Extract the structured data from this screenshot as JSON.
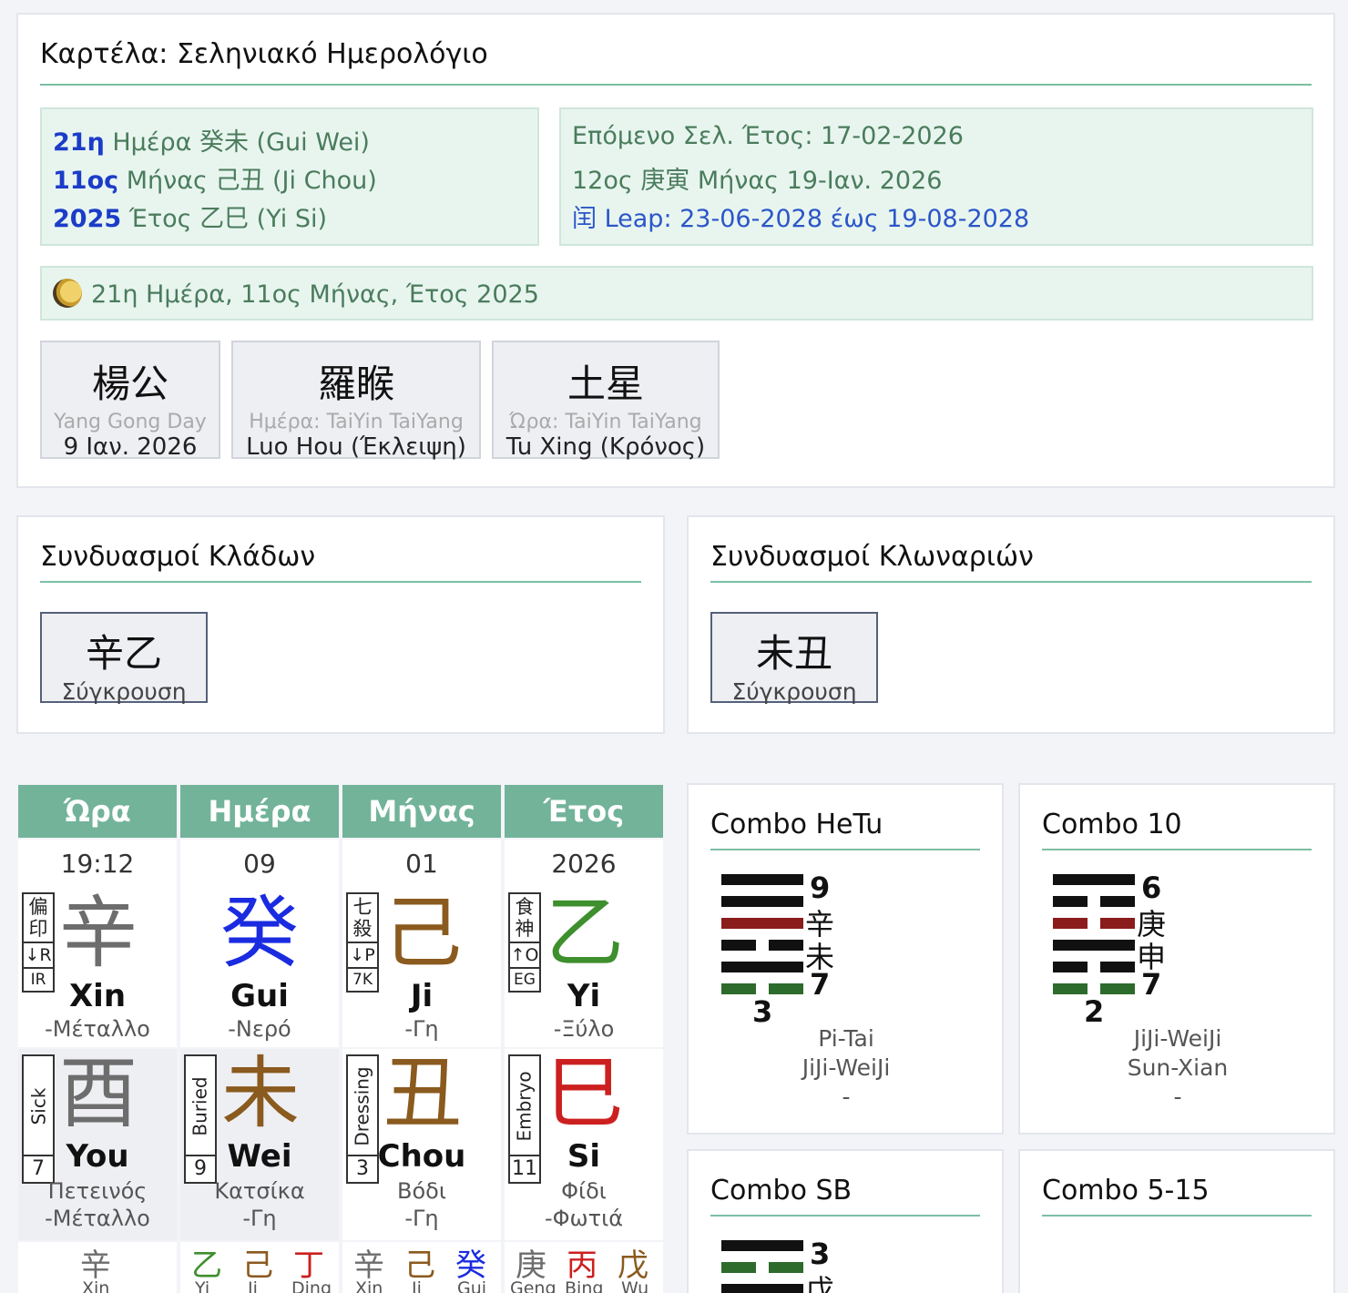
{
  "top": {
    "title": "Καρτέλα: Σεληνιακό Ημερολόγιο",
    "left_box": [
      {
        "num": "21η",
        "text": " Ημέρα 癸未 (Gui Wei)"
      },
      {
        "num": "11ος",
        "text": " Μήνας 己丑 (Ji Chou)"
      },
      {
        "num": "2025",
        "text": " Έτος 乙巳 (Yi Si)"
      }
    ],
    "right_box": {
      "next_year": "Επόμενο Σελ. Έτος: 17-02-2026",
      "next_month": "12ος 庚寅 Μήνας 19-Ιαν. 2026",
      "leap": "闰 Leap: 23-06-2028 έως 19-08-2028"
    },
    "moon_line": "21η Ημέρα, 11ος Μήνας, Έτος 2025",
    "tiles": [
      {
        "big": "楊公",
        "sub": "Yang Gong Day",
        "foot": "9 Ιαν. 2026"
      },
      {
        "big": "羅睺",
        "sub": "Ημέρα: TaiYin TaiYang",
        "foot": "Luo Hou (Έκλειψη)"
      },
      {
        "big": "土星",
        "sub": "Ώρα: TaiYin TaiYang",
        "foot": "Tu Xing (Κρόνος)"
      }
    ]
  },
  "stem_combos": {
    "title": "Συνδυασμοί Κλάδων",
    "tile": {
      "big": "辛乙",
      "sub": "Σύγκρουση"
    }
  },
  "branch_combos": {
    "title": "Συνδυασμοί Κλωναριών",
    "tile": {
      "big": "未丑",
      "sub": "Σύγκρουση"
    }
  },
  "pillars": [
    {
      "header": "Ώρα",
      "date": "19:12",
      "stem": {
        "tag1": "偏印",
        "tag2": "↓R",
        "tag3": "IR",
        "glyph": "辛",
        "pinyin": "Xin",
        "element": "-Μέταλλο",
        "color": "gray"
      },
      "branch": {
        "tag": "Sick",
        "num": "7",
        "glyph": "酉",
        "pinyin": "You",
        "animal": "Πετεινός",
        "element": "-Μέταλλο",
        "color": "gray"
      },
      "hidden": [
        {
          "g": "辛",
          "p": "Xin",
          "color": "gray"
        }
      ]
    },
    {
      "header": "Ημέρα",
      "date": "09",
      "stem": {
        "tag1": "",
        "tag2": "",
        "tag3": "",
        "glyph": "癸",
        "pinyin": "Gui",
        "element": "-Νερό",
        "color": "bl"
      },
      "branch": {
        "tag": "Buried",
        "num": "9",
        "glyph": "未",
        "pinyin": "Wei",
        "animal": "Κατσίκα",
        "element": "-Γη",
        "color": "br"
      },
      "hidden": [
        {
          "g": "乙",
          "p": "Yi",
          "color": "gr"
        },
        {
          "g": "己",
          "p": "Ji",
          "color": "br"
        },
        {
          "g": "丁",
          "p": "Ding",
          "color": "rd"
        }
      ]
    },
    {
      "header": "Μήνας",
      "date": "01",
      "stem": {
        "tag1": "七殺",
        "tag2": "↓P",
        "tag3": "7K",
        "glyph": "己",
        "pinyin": "Ji",
        "element": "-Γη",
        "color": "br"
      },
      "branch": {
        "tag": "Dressing",
        "num": "3",
        "glyph": "丑",
        "pinyin": "Chou",
        "animal": "Βόδι",
        "element": "-Γη",
        "color": "br"
      },
      "hidden": [
        {
          "g": "辛",
          "p": "Xin",
          "color": "gray"
        },
        {
          "g": "己",
          "p": "Ji",
          "color": "br"
        },
        {
          "g": "癸",
          "p": "Gui",
          "color": "bl"
        }
      ]
    },
    {
      "header": "Έτος",
      "date": "2026",
      "stem": {
        "tag1": "食神",
        "tag2": "↑O",
        "tag3": "EG",
        "glyph": "乙",
        "pinyin": "Yi",
        "element": "-Ξύλο",
        "color": "gr"
      },
      "branch": {
        "tag": "Embryo",
        "num": "11",
        "glyph": "巳",
        "pinyin": "Si",
        "animal": "Φίδι",
        "element": "-Φωτιά",
        "color": "rd"
      },
      "hidden": [
        {
          "g": "庚",
          "p": "Geng",
          "color": "gray"
        },
        {
          "g": "丙",
          "p": "Bing",
          "color": "rd"
        },
        {
          "g": "戊",
          "p": "Wu",
          "color": "br"
        }
      ]
    }
  ],
  "combos": {
    "hetu": {
      "title": "Combo HeTu",
      "top": "9",
      "c1": "辛",
      "c2": "未",
      "right": "7",
      "bottom": "3",
      "names": [
        "Pi-Tai",
        "JiJi-WeiJi",
        "-"
      ]
    },
    "ten": {
      "title": "Combo 10",
      "top": "6",
      "c1": "庚",
      "c2": "申",
      "right": "7",
      "bottom": "2",
      "names": [
        "JiJi-WeiJi",
        "Sun-Xian",
        "-"
      ]
    },
    "sb": {
      "title": "Combo SB",
      "top": "3",
      "c1": "戊"
    },
    "fifteen": {
      "title": "Combo 5-15"
    }
  }
}
